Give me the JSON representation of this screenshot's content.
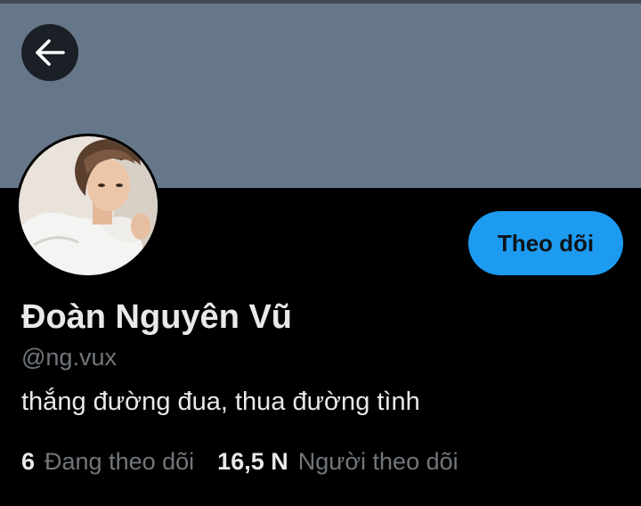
{
  "header": {
    "back_icon": "arrow-left-icon",
    "banner_color": "#66778a"
  },
  "profile": {
    "display_name": "Đoàn Nguyên Vũ",
    "handle": "@ng.vux",
    "bio": "thắng đường đua, thua đường tình",
    "follow_button_label": "Theo dõi",
    "avatar_icon": "profile-photo"
  },
  "stats": {
    "following_count": "6",
    "following_label": "Đang theo dõi",
    "followers_count": "16,5 N",
    "followers_label": "Người theo dõi"
  },
  "colors": {
    "accent": "#1d9bf0",
    "background": "#000000",
    "text_primary": "#e7e9ea",
    "text_secondary": "#71767b"
  }
}
